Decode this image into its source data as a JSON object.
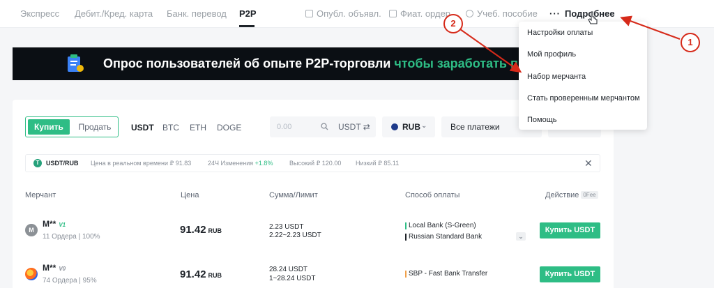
{
  "nav": {
    "tabs": [
      "Экспресс",
      "Дебит./Кред. карта",
      "Банк. перевод",
      "P2P"
    ],
    "active_tab": "P2P",
    "right_links": [
      "Опубл. объявл.",
      "Фиат. ордер",
      "Учеб. пособие"
    ],
    "more_label": "Подробнее"
  },
  "banner": {
    "text_white": "Опрос пользователей об опыте P2P-торговли",
    "text_green": "чтобы заработать п"
  },
  "filters": {
    "buy": "Купить",
    "sell": "Продать",
    "coins": [
      "USDT",
      "BTC",
      "ETH",
      "DOGE"
    ],
    "amount_placeholder": "0.00",
    "amount_currency": "USDT ⇄",
    "fiat": "RUB",
    "payment": "Все платежи"
  },
  "ticker": {
    "pair": "USDT/RUB",
    "realtime_label": "Цена в реальном времени ₽ 91.83",
    "change_label": "24Ч Изменения",
    "change_value": "+1.8%",
    "high": "Высокий ₽ 120.00",
    "low": "Низкий ₽ 85.11"
  },
  "table": {
    "headers": [
      "Мерчант",
      "Цена",
      "Сумма/Лимит",
      "Способ оплаты",
      "Действие"
    ],
    "fee_badge": "0Fee",
    "rows": [
      {
        "avatar": "M",
        "name": "M**",
        "badge": "V1",
        "orders": "11 Ордера | 100%",
        "price": "91.42",
        "currency": "RUB",
        "amount": "2.23 USDT",
        "limit": "2.22~2.23 USDT",
        "payments": [
          "Local Bank (S-Green)",
          "Russian Standard Bank"
        ],
        "action": "Купить USDT"
      },
      {
        "avatar": "",
        "name": "M**",
        "badge": "V0",
        "orders": "74 Ордера | 95%",
        "price": "91.42",
        "currency": "RUB",
        "amount": "28.24 USDT",
        "limit": "1~28.24 USDT",
        "payments": [
          "SBP - Fast Bank Transfer"
        ],
        "action": "Купить USDT"
      }
    ]
  },
  "dropdown": {
    "items": [
      "Настройки оплаты",
      "Мой профиль",
      "Набор мерчанта",
      "Стать проверенным мерчантом",
      "Помощь"
    ]
  },
  "annotations": {
    "num1": "1",
    "num2": "2",
    "color": "#d62a1a"
  }
}
